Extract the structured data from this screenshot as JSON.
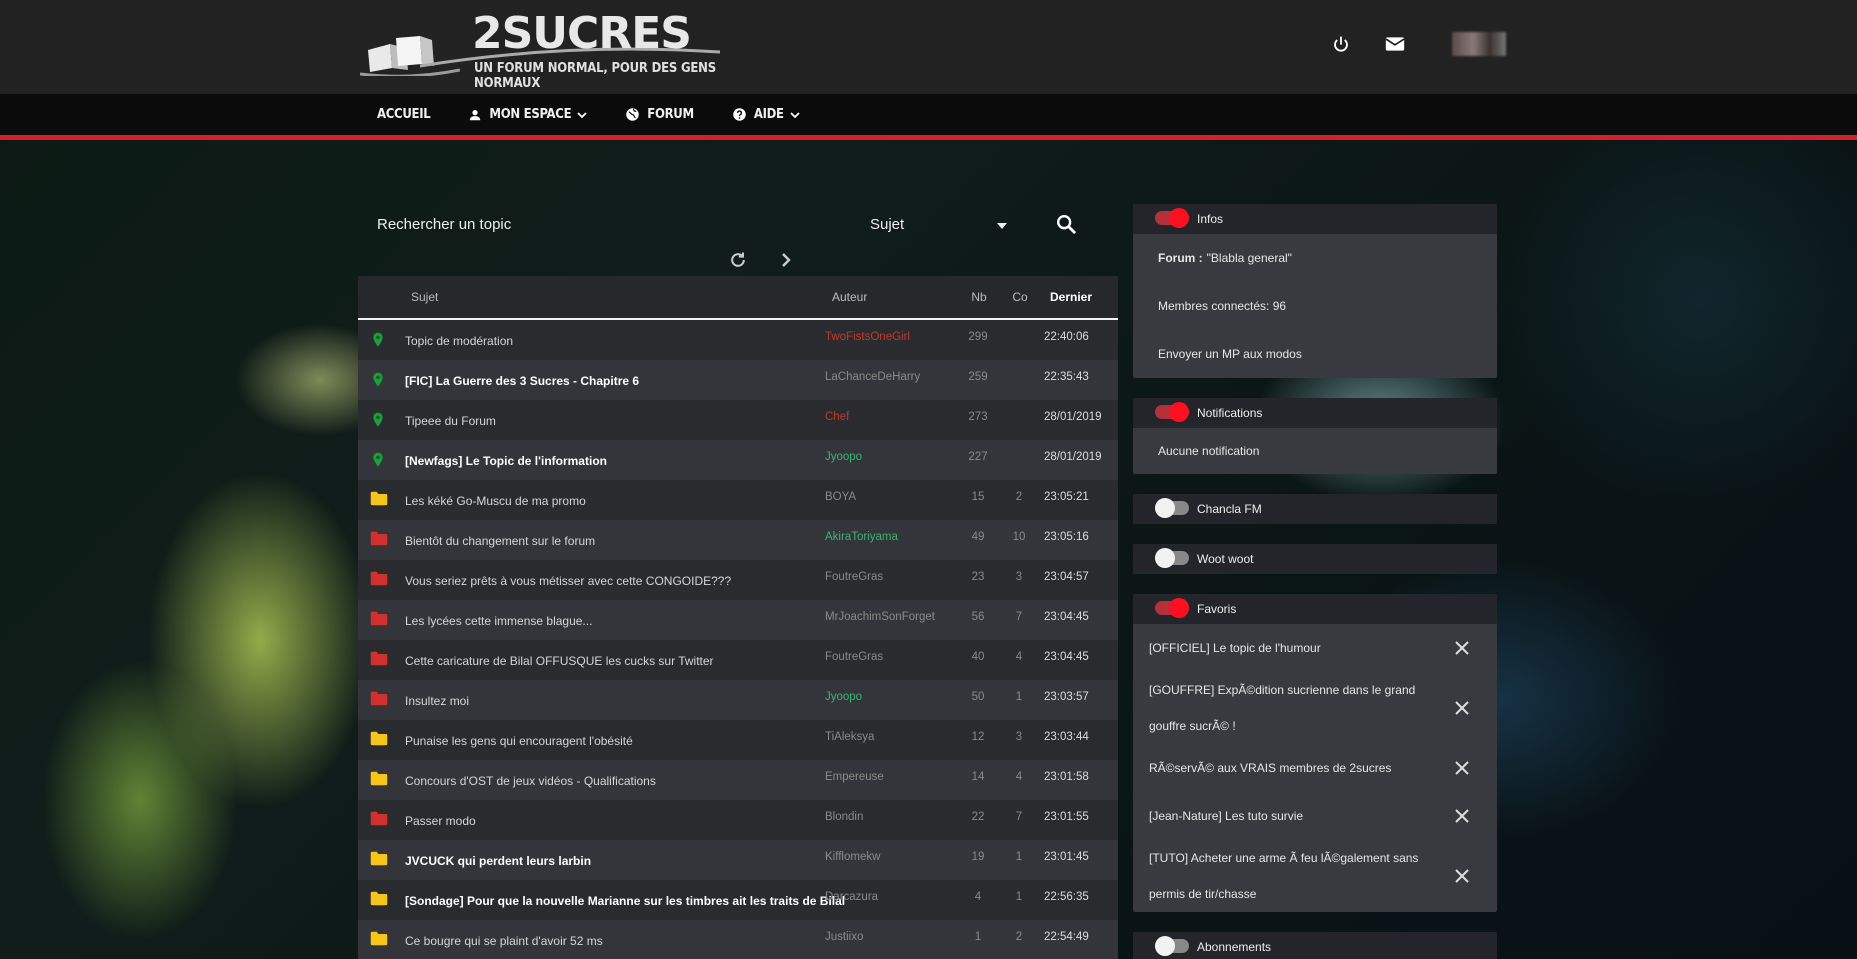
{
  "header": {
    "brand": "2SUCRES",
    "tagline": "UN FORUM NORMAL, POUR DES GENS NORMAUX"
  },
  "nav": [
    {
      "label": "ACCUEIL",
      "icon": "",
      "dropdown": false
    },
    {
      "label": "MON ESPACE",
      "icon": "person-icon",
      "dropdown": true
    },
    {
      "label": "FORUM",
      "icon": "globe-icon",
      "dropdown": false
    },
    {
      "label": "AIDE",
      "icon": "help-icon",
      "dropdown": true
    }
  ],
  "search": {
    "placeholder": "Rechercher un topic",
    "select_value": "Sujet"
  },
  "table": {
    "headers": {
      "subject": "Sujet",
      "author": "Auteur",
      "nb": "Nb",
      "co": "Co",
      "last": "Dernier"
    },
    "rows": [
      {
        "icon": "pin-green",
        "subject": "Topic de modération",
        "bold": false,
        "author": "TwoFistsOneGirl",
        "author_color": "red",
        "nb": "299",
        "co": "",
        "last": "22:40:06"
      },
      {
        "icon": "pin-green",
        "subject": "[FIC] La Guerre des 3 Sucres - Chapitre 6",
        "bold": true,
        "author": "LaChanceDeHarry",
        "author_color": "gray",
        "nb": "259",
        "co": "",
        "last": "22:35:43"
      },
      {
        "icon": "pin-green",
        "subject": "Tipeee du Forum",
        "bold": false,
        "author": "Chef",
        "author_color": "red",
        "nb": "273",
        "co": "",
        "last": "28/01/2019"
      },
      {
        "icon": "pin-green",
        "subject": "[Newfags] Le Topic de l'information",
        "bold": true,
        "author": "Jyoopo",
        "author_color": "green",
        "nb": "227",
        "co": "",
        "last": "28/01/2019"
      },
      {
        "icon": "folder-yellow",
        "subject": "Les kéké Go-Muscu de ma promo",
        "bold": false,
        "author": "BOYA",
        "author_color": "gray",
        "nb": "15",
        "co": "2",
        "last": "23:05:21"
      },
      {
        "icon": "folder-red",
        "subject": "Bientôt du changement sur le forum",
        "bold": false,
        "author": "AkiraToriyama",
        "author_color": "green",
        "nb": "49",
        "co": "10",
        "last": "23:05:16"
      },
      {
        "icon": "folder-red",
        "subject": "Vous seriez prêts à vous métisser avec cette CONGOIDE???",
        "bold": false,
        "author": "FoutreGras",
        "author_color": "gray",
        "nb": "23",
        "co": "3",
        "last": "23:04:57"
      },
      {
        "icon": "folder-red",
        "subject": "Les lycées cette immense blague...",
        "bold": false,
        "author": "MrJoachimSonForget",
        "author_color": "gray",
        "nb": "56",
        "co": "7",
        "last": "23:04:45"
      },
      {
        "icon": "folder-red",
        "subject": "Cette caricature de Bilal OFFUSQUE les cucks sur Twitter",
        "bold": false,
        "author": "FoutreGras",
        "author_color": "gray",
        "nb": "40",
        "co": "4",
        "last": "23:04:45"
      },
      {
        "icon": "folder-red",
        "subject": "Insultez moi",
        "bold": false,
        "author": "Jyoopo",
        "author_color": "green",
        "nb": "50",
        "co": "1",
        "last": "23:03:57"
      },
      {
        "icon": "folder-yellow",
        "subject": "Punaise les gens qui encouragent l'obésité",
        "bold": false,
        "author": "TiAleksya",
        "author_color": "gray",
        "nb": "12",
        "co": "3",
        "last": "23:03:44"
      },
      {
        "icon": "folder-yellow",
        "subject": "Concours d'OST de jeux vidéos - Qualifications",
        "bold": false,
        "author": "Empereuse",
        "author_color": "gray",
        "nb": "14",
        "co": "4",
        "last": "23:01:58"
      },
      {
        "icon": "folder-red",
        "subject": "Passer modo",
        "bold": false,
        "author": "Blondin",
        "author_color": "gray",
        "nb": "22",
        "co": "7",
        "last": "23:01:55"
      },
      {
        "icon": "folder-yellow",
        "subject": "JVCUCK qui perdent leurs larbin",
        "bold": true,
        "author": "Kifflomekw",
        "author_color": "gray",
        "nb": "19",
        "co": "1",
        "last": "23:01:45"
      },
      {
        "icon": "folder-yellow",
        "subject": "[Sondage] Pour que la nouvelle Marianne sur les timbres ait les traits de Bilal",
        "bold": true,
        "author": "Darcazura",
        "author_color": "gray",
        "nb": "4",
        "co": "1",
        "last": "22:56:35"
      },
      {
        "icon": "folder-yellow",
        "subject": "Ce bougre qui se plaint d'avoir 52 ms",
        "bold": false,
        "author": "Justiixo",
        "author_color": "gray",
        "nb": "1",
        "co": "2",
        "last": "22:54:49"
      }
    ]
  },
  "sidebar": {
    "infos": {
      "title": "Infos",
      "on": true,
      "forum_label": "Forum :",
      "forum_value": "\"Blabla general\"",
      "members": "Membres connectés: 96",
      "mp_link": "Envoyer un MP aux modos"
    },
    "notifications": {
      "title": "Notifications",
      "on": true,
      "empty": "Aucune notification"
    },
    "chancla": {
      "title": "Chancla FM",
      "on": false
    },
    "woot": {
      "title": "Woot woot",
      "on": false
    },
    "favoris": {
      "title": "Favoris",
      "on": true,
      "items": [
        "[OFFICIEL] Le topic de l'humour",
        "[GOUFFRE] ExpÃ©dition sucrienne dans le grand gouffre sucrÃ© !",
        "RÃ©servÃ© aux VRAIS membres de 2sucres",
        "[Jean-Nature] Les tuto survie",
        "[TUTO] Acheter une arme Ã  feu lÃ©galement sans permis de tir/chasse"
      ]
    },
    "abonnements": {
      "title": "Abonnements",
      "on": false
    }
  },
  "colors": {
    "accent": "#d4202a",
    "pin": "#1e9b3a",
    "folder_yellow": "#f5c518",
    "folder_red": "#d32f2f"
  }
}
